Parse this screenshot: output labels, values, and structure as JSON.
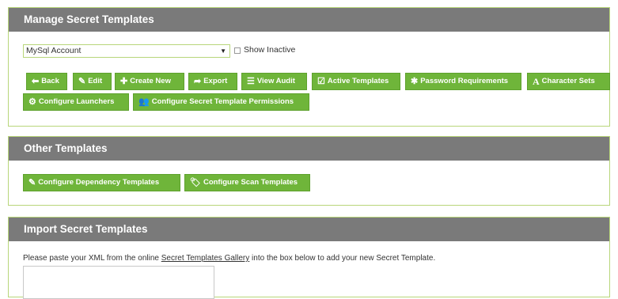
{
  "manage": {
    "title": "Manage Secret Templates",
    "select_value": "MySql Account",
    "show_inactive": "Show Inactive",
    "buttons": {
      "back": "Back",
      "edit": "Edit",
      "create_new": "Create New",
      "export": "Export",
      "view_audit": "View Audit",
      "active_templates": "Active Templates",
      "password_requirements": "Password Requirements",
      "character_sets": "Character Sets",
      "configure_launchers": "Configure Launchers",
      "configure_permissions": "Configure Secret Template Permissions"
    }
  },
  "other": {
    "title": "Other Templates",
    "buttons": {
      "dependency": "Configure Dependency Templates",
      "scan": "Configure Scan Templates"
    }
  },
  "import": {
    "title": "Import Secret Templates",
    "text_before": "Please paste your XML from the online ",
    "link": "Secret Templates Gallery",
    "text_after": " into the box below to add your new Secret Template."
  },
  "colors": {
    "header": "#7a7a7a",
    "button": "#6fb53a",
    "border": "#b8d67a"
  },
  "icons": [
    "back-arrow-icon",
    "edit-icon",
    "plus-icon",
    "export-icon",
    "list-icon",
    "check-square-icon",
    "asterisk-icon",
    "font-icon",
    "gears-icon",
    "users-icon",
    "edit-icon",
    "tag-icon",
    "caret-down-icon",
    "checkbox-icon"
  ]
}
